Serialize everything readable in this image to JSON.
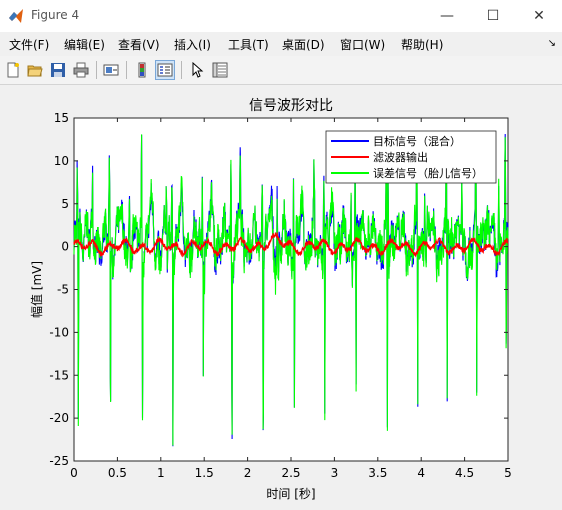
{
  "window": {
    "title": "Figure 4",
    "controls": {
      "minimize": "—",
      "maximize": "☐",
      "close": "✕"
    }
  },
  "menu": {
    "items": [
      {
        "label": "文件(F)"
      },
      {
        "label": "编辑(E)"
      },
      {
        "label": "查看(V)"
      },
      {
        "label": "插入(I)"
      },
      {
        "label": "工具(T)"
      },
      {
        "label": "桌面(D)"
      },
      {
        "label": "窗口(W)"
      },
      {
        "label": "帮助(H)"
      }
    ],
    "overflow_icon": "corner-arrow-icon"
  },
  "toolbar": {
    "buttons": [
      {
        "icon": "new-figure-icon"
      },
      {
        "icon": "open-file-icon"
      },
      {
        "icon": "save-icon"
      },
      {
        "icon": "print-icon"
      },
      {
        "icon": "link-plot-icon"
      },
      {
        "icon": "insert-colorbar-icon"
      },
      {
        "icon": "insert-legend-icon"
      },
      {
        "icon": "edit-plot-pointer-icon"
      },
      {
        "icon": "property-inspector-icon"
      }
    ]
  },
  "colors": {
    "target": "#0000ff",
    "filter": "#ff0000",
    "error": "#00ff00"
  },
  "chart_data": {
    "type": "line",
    "title": "信号波形对比",
    "xlabel": "时间 [秒]",
    "ylabel": "幅值 [mV]",
    "xlim": [
      0,
      5
    ],
    "ylim": [
      -25,
      15
    ],
    "xticks": [
      "0",
      "0.5",
      "1",
      "1.5",
      "2",
      "2.5",
      "3",
      "3.5",
      "4",
      "4.5",
      "5"
    ],
    "yticks": [
      "-25",
      "-20",
      "-15",
      "-10",
      "-5",
      "0",
      "5",
      "10",
      "15"
    ],
    "grid": false,
    "legend_position": "top-right",
    "maternal_beats": {
      "times": [
        0.05,
        0.42,
        0.79,
        1.14,
        1.49,
        1.82,
        2.18,
        2.54,
        2.89,
        3.25,
        3.61,
        3.96,
        4.3,
        4.64,
        4.98
      ],
      "negative_peaks": [
        -23.5,
        -23.5,
        -20,
        -20.5,
        -18,
        -22,
        -23,
        -19,
        -20,
        -19,
        -24,
        -21,
        -20,
        -19.5,
        -18
      ],
      "positive_peaks": [
        9,
        9,
        11.5,
        10.5,
        8.5,
        9,
        11,
        8.5,
        8.7,
        8.5,
        9.5,
        9,
        8.5,
        9,
        9
      ]
    },
    "series": [
      {
        "name": "目标信号（混合）",
        "color": "#0000ff"
      },
      {
        "name": "滤波器输出",
        "color": "#ff0000"
      },
      {
        "name": "误差信号（胎儿信号）",
        "color": "#00ff00"
      }
    ]
  }
}
